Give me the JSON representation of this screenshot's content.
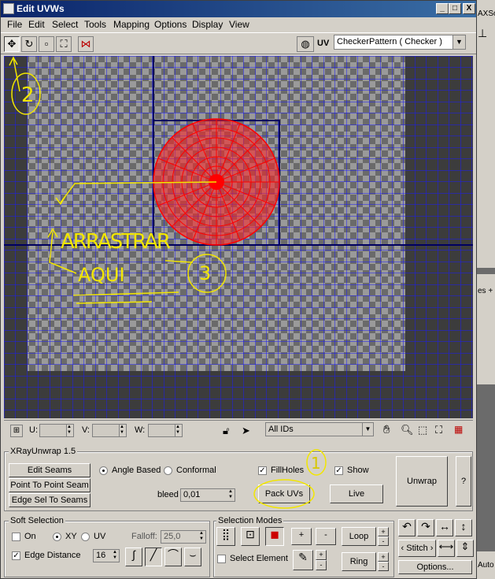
{
  "window": {
    "title": "Edit UVWs",
    "minimize": "_",
    "maximize": "□",
    "close": "X"
  },
  "menu": [
    "File",
    "Edit",
    "Select",
    "Tools",
    "Mapping",
    "Options",
    "Display",
    "View"
  ],
  "toolbar": {
    "uv_label": "UV",
    "texture_value": "CheckerPattern  ( Checker )"
  },
  "uvbar": {
    "u_label": "U:",
    "v_label": "V:",
    "w_label": "W:",
    "ids_value": "All IDs"
  },
  "annotations": {
    "num1": "1",
    "num2": "2",
    "num3": "3",
    "drag_line1": "ARRASTRAR",
    "drag_line2": "AQUI"
  },
  "xray": {
    "group_title": "XRayUnwrap 1.5",
    "edit_seams": "Edit Seams",
    "point_to_point": "Point To Point Seam",
    "edge_sel_to_seams": "Edge Sel To Seams",
    "angle_based": "Angle Based",
    "conformal": "Conformal",
    "fillholes": "FillHoles",
    "show": "Show",
    "bleed_label": "bleed",
    "bleed_value": "0,01",
    "pack_uvs": "Pack UVs",
    "live": "Live",
    "unwrap": "Unwrap",
    "help": "?"
  },
  "soft": {
    "group_title": "Soft Selection",
    "on": "On",
    "xy": "XY",
    "uv": "UV",
    "falloff_label": "Falloff:",
    "falloff_value": "25,0",
    "edge_distance": "Edge Distance",
    "edge_distance_value": "16"
  },
  "modes": {
    "group_title": "Selection Modes",
    "select_element": "Select Element",
    "loop": "Loop",
    "ring": "Ring",
    "plus": "+",
    "minus": "-",
    "stitch": "Stitch",
    "options": "Options..."
  },
  "side": {
    "top_text": "AXSo",
    "mid_text": "es +",
    "bottom_text": "Auto"
  },
  "colors": {
    "title_bar": "#0a246a",
    "uv_mesh": "#ff0000",
    "grid": "#1a1aff",
    "annotation": "#f2e600"
  }
}
